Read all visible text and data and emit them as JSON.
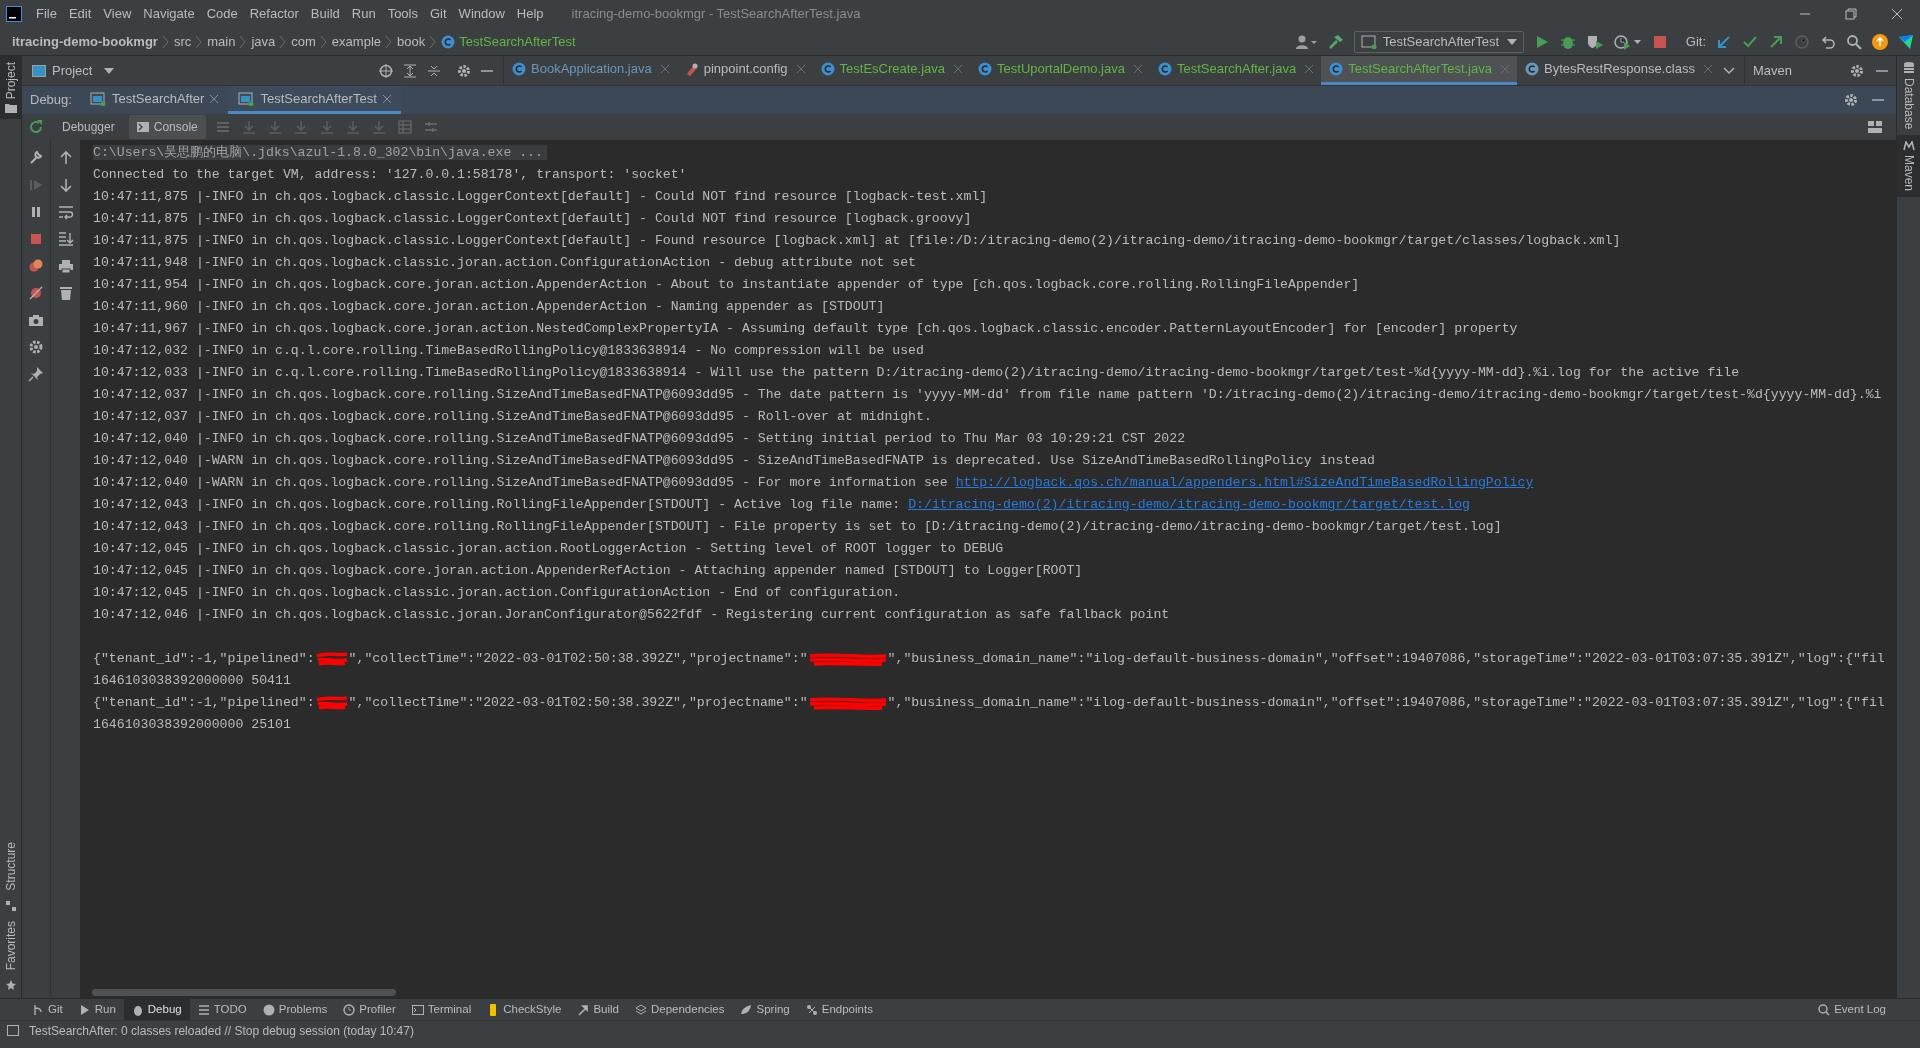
{
  "menu": {
    "items": [
      "File",
      "Edit",
      "View",
      "Navigate",
      "Code",
      "Refactor",
      "Build",
      "Run",
      "Tools",
      "Git",
      "Window",
      "Help"
    ],
    "title": "itracing-demo-bookmgr - TestSearchAfterTest.java"
  },
  "breadcrumb": {
    "project": "itracing-demo-bookmgr",
    "items": [
      "src",
      "main",
      "java",
      "com",
      "example",
      "book"
    ],
    "current": "TestSearchAfterTest"
  },
  "toolbar": {
    "run_config": "TestSearchAfterTest",
    "git_label": "Git:"
  },
  "side_left": {
    "top": "Project",
    "bottom": [
      "Structure",
      "Favorites"
    ]
  },
  "side_right": [
    "Database",
    "Maven"
  ],
  "project_panel": {
    "title": "Project"
  },
  "editor_tabs": [
    {
      "label": "BookApplication.java",
      "selected": false,
      "color": "#6897bb"
    },
    {
      "label": "pinpoint.config",
      "selected": false,
      "color": "#bbbbbb"
    },
    {
      "label": "TestEsCreate.java",
      "selected": false,
      "color": "#62b543"
    },
    {
      "label": "TestUportalDemo.java",
      "selected": false,
      "color": "#62b543"
    },
    {
      "label": "TestSearchAfter.java",
      "selected": false,
      "color": "#62b543"
    },
    {
      "label": "TestSearchAfterTest.java",
      "selected": true,
      "color": "#62b543"
    },
    {
      "label": "BytesRestResponse.class",
      "selected": false,
      "color": "#bbbbbb"
    }
  ],
  "maven_panel": {
    "title": "Maven"
  },
  "debug": {
    "label": "Debug:",
    "tabs": [
      {
        "label": "TestSearchAfter",
        "selected": false
      },
      {
        "label": "TestSearchAfterTest",
        "selected": true
      }
    ],
    "views": [
      {
        "label": "Debugger",
        "selected": false
      },
      {
        "label": "Console",
        "selected": true
      }
    ]
  },
  "console": {
    "lines": [
      {
        "kind": "command",
        "text": "C:\\Users\\吴思鹏的电脑\\.jdks\\azul-1.8.0_302\\bin\\java.exe ..."
      },
      {
        "kind": "plain",
        "text": "Connected to the target VM, address: '127.0.0.1:58178', transport: 'socket'"
      },
      {
        "kind": "plain",
        "text": "10:47:11,875 |-INFO in ch.qos.logback.classic.LoggerContext[default] - Could NOT find resource [logback-test.xml]"
      },
      {
        "kind": "plain",
        "text": "10:47:11,875 |-INFO in ch.qos.logback.classic.LoggerContext[default] - Could NOT find resource [logback.groovy]"
      },
      {
        "kind": "plain",
        "text": "10:47:11,875 |-INFO in ch.qos.logback.classic.LoggerContext[default] - Found resource [logback.xml] at [file:/D:/itracing-demo(2)/itracing-demo/itracing-demo-bookmgr/target/classes/logback.xml]"
      },
      {
        "kind": "plain",
        "text": "10:47:11,948 |-INFO in ch.qos.logback.classic.joran.action.ConfigurationAction - debug attribute not set"
      },
      {
        "kind": "plain",
        "text": "10:47:11,954 |-INFO in ch.qos.logback.core.joran.action.AppenderAction - About to instantiate appender of type [ch.qos.logback.core.rolling.RollingFileAppender]"
      },
      {
        "kind": "plain",
        "text": "10:47:11,960 |-INFO in ch.qos.logback.core.joran.action.AppenderAction - Naming appender as [STDOUT]"
      },
      {
        "kind": "plain",
        "text": "10:47:11,967 |-INFO in ch.qos.logback.core.joran.action.NestedComplexPropertyIA - Assuming default type [ch.qos.logback.classic.encoder.PatternLayoutEncoder] for [encoder] property"
      },
      {
        "kind": "plain",
        "text": "10:47:12,032 |-INFO in c.q.l.core.rolling.TimeBasedRollingPolicy@1833638914 - No compression will be used"
      },
      {
        "kind": "plain",
        "text": "10:47:12,033 |-INFO in c.q.l.core.rolling.TimeBasedRollingPolicy@1833638914 - Will use the pattern D:/itracing-demo(2)/itracing-demo/itracing-demo-bookmgr/target/test-%d{yyyy-MM-dd}.%i.log for the active file"
      },
      {
        "kind": "plain",
        "text": "10:47:12,037 |-INFO in ch.qos.logback.core.rolling.SizeAndTimeBasedFNATP@6093dd95 - The date pattern is 'yyyy-MM-dd' from file name pattern 'D:/itracing-demo(2)/itracing-demo/itracing-demo-bookmgr/target/test-%d{yyyy-MM-dd}.%i"
      },
      {
        "kind": "plain",
        "text": "10:47:12,037 |-INFO in ch.qos.logback.core.rolling.SizeAndTimeBasedFNATP@6093dd95 - Roll-over at midnight."
      },
      {
        "kind": "plain",
        "text": "10:47:12,040 |-INFO in ch.qos.logback.core.rolling.SizeAndTimeBasedFNATP@6093dd95 - Setting initial period to Thu Mar 03 10:29:21 CST 2022"
      },
      {
        "kind": "plain",
        "text": "10:47:12,040 |-WARN in ch.qos.logback.core.rolling.SizeAndTimeBasedFNATP@6093dd95 - SizeAndTimeBasedFNATP is deprecated. Use SizeAndTimeBasedRollingPolicy instead"
      },
      {
        "kind": "link",
        "text": "10:47:12,040 |-WARN in ch.qos.logback.core.rolling.SizeAndTimeBasedFNATP@6093dd95 - For more information see",
        "link": "http://logback.qos.ch/manual/appenders.html#SizeAndTimeBasedRollingPolicy"
      },
      {
        "kind": "link",
        "text": "10:47:12,043 |-INFO in ch.qos.logback.core.rolling.RollingFileAppender[STDOUT] - Active log file name:",
        "link": "D:/itracing-demo(2)/itracing-demo/itracing-demo-bookmgr/target/test.log"
      },
      {
        "kind": "plain",
        "text": "10:47:12,043 |-INFO in ch.qos.logback.core.rolling.RollingFileAppender[STDOUT] - File property is set to [D:/itracing-demo(2)/itracing-demo/itracing-demo-bookmgr/target/test.log]"
      },
      {
        "kind": "plain",
        "text": "10:47:12,045 |-INFO in ch.qos.logback.classic.joran.action.RootLoggerAction - Setting level of ROOT logger to DEBUG"
      },
      {
        "kind": "plain",
        "text": "10:47:12,045 |-INFO in ch.qos.logback.core.joran.action.AppenderRefAction - Attaching appender named [STDOUT] to Logger[ROOT]"
      },
      {
        "kind": "plain",
        "text": "10:47:12,045 |-INFO in ch.qos.logback.classic.joran.action.ConfigurationAction - End of configuration."
      },
      {
        "kind": "plain",
        "text": "10:47:12,046 |-INFO in ch.qos.logback.classic.joran.JoranConfigurator@5622fdf - Registering current configuration as safe fallback point"
      },
      {
        "kind": "redacted",
        "gap_before": true,
        "parts": [
          "{\"tenant_id\":-1,\"pipelined\":",
          "\",\"collectTime\":\"2022-03-01T02:50:38.392Z\",\"projectname\":\"",
          "\",\"business_domain_name\":\"ilog-default-business-domain\",\"offset\":19407086,\"storageTime\":\"2022-03-01T03:07:35.391Z\",\"log\":{\"fil"
        ]
      },
      {
        "kind": "plain",
        "text": "1646103038392000000 50411"
      },
      {
        "kind": "redacted",
        "parts": [
          "{\"tenant_id\":-1,\"pipelined\":",
          "\",\"collectTime\":\"2022-03-01T02:50:38.392Z\",\"projectname\":\"",
          "\",\"business_domain_name\":\"ilog-default-business-domain\",\"offset\":19407086,\"storageTime\":\"2022-03-01T03:07:35.391Z\",\"log\":{\"fil"
        ]
      },
      {
        "kind": "plain",
        "text": "1646103038392000000 25101"
      }
    ]
  },
  "bottom_tabs": [
    {
      "label": "Git",
      "selected": false
    },
    {
      "label": "Run",
      "selected": false
    },
    {
      "label": "Debug",
      "selected": true
    },
    {
      "label": "TODO",
      "selected": false
    },
    {
      "label": "Problems",
      "selected": false
    },
    {
      "label": "Profiler",
      "selected": false
    },
    {
      "label": "Terminal",
      "selected": false
    },
    {
      "label": "CheckStyle",
      "selected": false
    },
    {
      "label": "Build",
      "selected": false
    },
    {
      "label": "Dependencies",
      "selected": false
    },
    {
      "label": "Spring",
      "selected": false
    },
    {
      "label": "Endpoints",
      "selected": false
    }
  ],
  "event_log": "Event Log",
  "status_bar": "TestSearchAfter: 0 classes reloaded // Stop debug session (today 10:47)"
}
